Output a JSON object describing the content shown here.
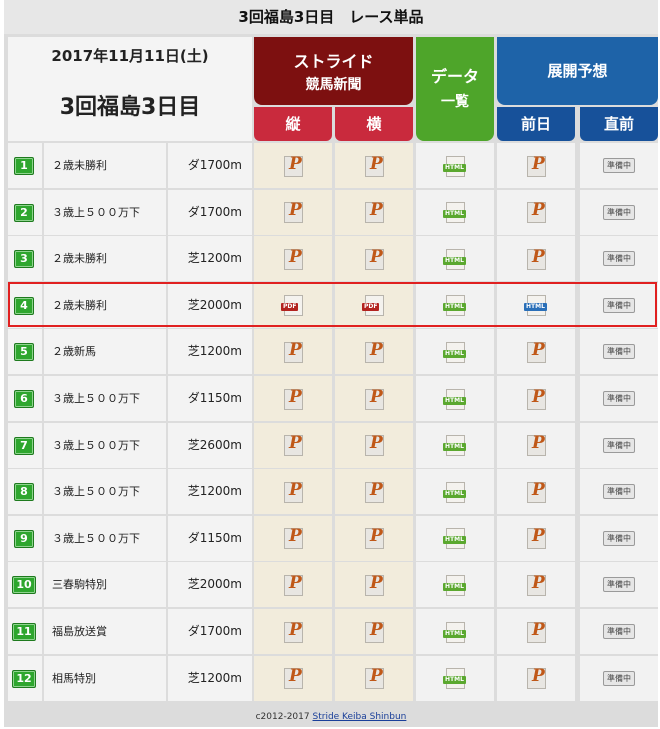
{
  "page_title": "3回福島3日目　レース単品",
  "header": {
    "date": "2017年11月11日(土)",
    "meeting": "3回福島3日目",
    "stride_line1": "ストライド",
    "stride_line2": "競馬新聞",
    "vertical": "縦",
    "horizontal": "横",
    "data_line1": "データ",
    "data_line2": "一覧",
    "forecast": "展開予想",
    "prev_day": "前日",
    "just_before": "直前"
  },
  "icon_labels": {
    "pdf": "PDF",
    "html": "HTML",
    "prep": "準備中"
  },
  "races": [
    {
      "no": "1",
      "name": "２歳未勝利",
      "dist": "ダ1700m",
      "pdf": false,
      "prev_html": false
    },
    {
      "no": "2",
      "name": "３歳上５００万下",
      "dist": "ダ1700m",
      "pdf": false,
      "prev_html": false
    },
    {
      "no": "3",
      "name": "２歳未勝利",
      "dist": "芝1200m",
      "pdf": false,
      "prev_html": false
    },
    {
      "no": "4",
      "name": "２歳未勝利",
      "dist": "芝2000m",
      "pdf": true,
      "prev_html": true
    },
    {
      "no": "5",
      "name": "２歳新馬",
      "dist": "芝1200m",
      "pdf": false,
      "prev_html": false
    },
    {
      "no": "6",
      "name": "３歳上５００万下",
      "dist": "ダ1150m",
      "pdf": false,
      "prev_html": false
    },
    {
      "no": "7",
      "name": "３歳上５００万下",
      "dist": "芝2600m",
      "pdf": false,
      "prev_html": false
    },
    {
      "no": "8",
      "name": "３歳上５００万下",
      "dist": "芝1200m",
      "pdf": false,
      "prev_html": false
    },
    {
      "no": "9",
      "name": "３歳上５００万下",
      "dist": "ダ1150m",
      "pdf": false,
      "prev_html": false
    },
    {
      "no": "10",
      "name": "三春駒特別",
      "dist": "芝2000m",
      "pdf": false,
      "prev_html": false
    },
    {
      "no": "11",
      "name": "福島放送賞",
      "dist": "ダ1700m",
      "pdf": false,
      "prev_html": false
    },
    {
      "no": "12",
      "name": "相馬特別",
      "dist": "芝1200m",
      "pdf": false,
      "prev_html": false
    }
  ],
  "footer": {
    "copyright": "c2012-2017",
    "link_text": "Stride Keiba Shinbun"
  },
  "colors": {
    "stride": "#7d1010",
    "stride_sub": "#c92a3d",
    "data": "#4ea52a",
    "forecast": "#1e63a8",
    "forecast_sub": "#17519a",
    "highlight": "#e02020"
  }
}
